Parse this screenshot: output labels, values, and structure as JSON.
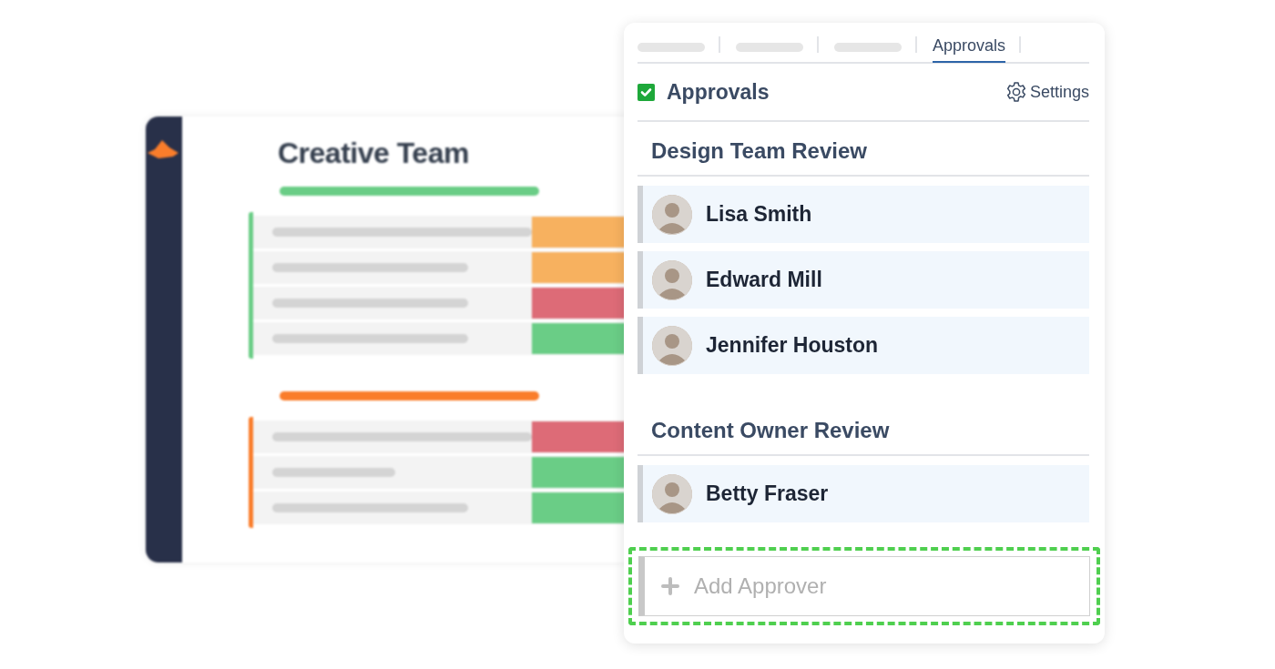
{
  "back_card": {
    "title": "Creative Team",
    "groups": [
      {
        "color": "#6acd86",
        "rows": [
          {
            "kind": "long",
            "color": "#f7b15f"
          },
          {
            "kind": "medium",
            "color": "#f7b15f"
          },
          {
            "kind": "medium",
            "color": "#dd6b77"
          },
          {
            "kind": "medium",
            "color": "#6acd86"
          }
        ]
      },
      {
        "color": "#fa7d2b",
        "rows": [
          {
            "kind": "long",
            "color": "#dd6b77"
          },
          {
            "kind": "short",
            "color": "#6acd86"
          },
          {
            "kind": "medium",
            "color": "#6acd86"
          }
        ]
      }
    ]
  },
  "panel": {
    "tabs": [
      {
        "kind": "placeholder",
        "selected": false
      },
      {
        "kind": "placeholder",
        "selected": false
      },
      {
        "kind": "placeholder",
        "selected": false
      },
      {
        "kind": "text",
        "label": "Approvals",
        "selected": true
      }
    ],
    "header": {
      "checked": true,
      "title": "Approvals",
      "settings": "Settings"
    },
    "groups": [
      {
        "name": "Design Team Review",
        "approvers": [
          {
            "name": "Lisa Smith"
          },
          {
            "name": "Edward Mill"
          },
          {
            "name": "Jennifer Houston"
          }
        ]
      },
      {
        "name": "Content Owner Review",
        "approvers": [
          {
            "name": "Betty Fraser"
          }
        ]
      }
    ],
    "add_field": {
      "placeholder": "Add Approver"
    }
  }
}
